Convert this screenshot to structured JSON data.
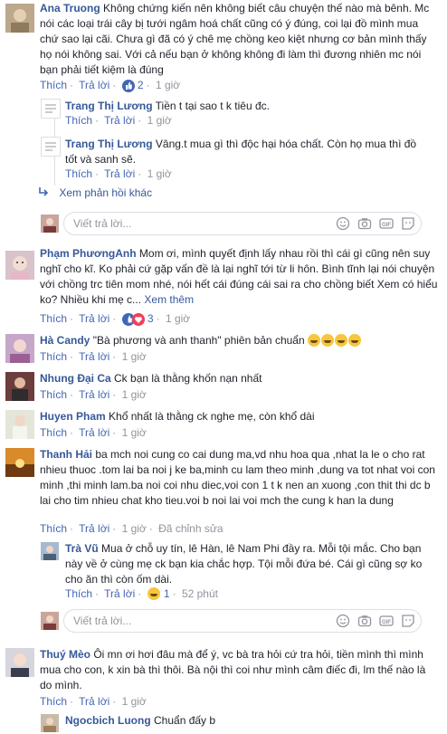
{
  "comments": [
    {
      "name": "Ana Truong",
      "text": "Không chứng kiến nên không biết câu chuyện thế nào mà bênh. Mc nói các loại trái cây bị tưới ngâm hoá chất cũng có ý đúng, coi lại đồ mình mua chứ sao lại cãi. Chưa gì đã có ý chê mẹ chồng keo kiệt nhưng cơ bản mình thấy họ nói không sai. Với cả nếu bạn ở không không đi làm thì đương nhiên mc nói bạn phải tiết kiệm là đúng",
      "like": "Thích",
      "reply": "Trả lời",
      "likes": "2",
      "time": "1 giờ"
    },
    {
      "name": "Trang Thị Lương",
      "text": "Tiền t tại sao t k tiêu đc.",
      "like": "Thích",
      "reply": "Trả lời",
      "time": "1 giờ"
    },
    {
      "name": "Trang Thị Lương",
      "text": "Vâng.t mua gì thì độc hại hóa chất. Còn họ mua thì đồ tốt và sanh sẽ.",
      "like": "Thích",
      "reply": "Trả lời",
      "time": "1 giờ"
    },
    {
      "name": "Phạm PhươngAnh",
      "text": "Mom ơi, mình quyết định lấy nhau rồi thì cái gì cũng nên suy nghĩ cho kĩ. Ko phải cứ gặp vấn đề là lại nghĩ tới từ li hôn. Bình tĩnh lại nói chuyện với chồng trc tiên mom nhé, nói hết cái đúng cái sai ra cho chồng biết Xem có hiểu ko? Nhiều khi mẹ c...",
      "more": "Xem thêm",
      "like": "Thích",
      "reply": "Trả lời",
      "likes": "3",
      "time": "1 giờ"
    },
    {
      "name": "Hà Candy",
      "text": "\"Bà phương và anh thanh\" phiên bản chuẩn",
      "like": "Thích",
      "reply": "Trả lời",
      "time": "1 giờ"
    },
    {
      "name": "Nhung Đại Ca",
      "text": "Ck bạn là thằng khốn nạn nhất",
      "like": "Thích",
      "reply": "Trả lời",
      "time": "1 giờ"
    },
    {
      "name": "Huyen Pham",
      "text": "Khổ nhất là thằng ck nghe mẹ, còn khổ dài",
      "like": "Thích",
      "reply": "Trả lời",
      "time": "1 giờ"
    },
    {
      "name": "Thanh Hải",
      "text": "ba mch noi cung co cai dung ma,vd nhu hoa qua ,nhat la le o cho rat nhieu thuoc .tom lai ba noi j ke ba,minh cu lam theo minh ,dung va tot nhat voi con minh ,thi minh lam.ba noi coi nhu diec,voi con 1 t k nen an xuong ,con thit thi dc b lai cho tim nhieu chat kho tieu.voi b noi lai voi mch the cung k han la dung",
      "like": "Thích",
      "reply": "Trả lời",
      "time": "1 giờ",
      "edited": "Đã chỉnh sửa"
    },
    {
      "name": "Trà Vũ",
      "text": "Mua ở chỗ uy tín, lê Hàn, lê Nam Phi đầy ra. Mỗi tội mắc. Cho bạn này về ở cùng mẹ ck bạn kia chắc hợp. Tội mỗi đứa bé. Cái gì cũng sợ ko cho ăn thì còn ốm dài.",
      "like": "Thích",
      "reply": "Trả lời",
      "likes": "1",
      "time": "52 phút"
    },
    {
      "name": "Thuý Mèo",
      "text": "Ôi mn ơi hơi đâu mà để ý, vc bà tra hỏi cứ tra hỏi, tiền mình thì mình mua cho con, k xin bà thì thôi. Bà nội thì coi như mình câm điếc đi, lm thế nào là do mình.",
      "like": "Thích",
      "reply": "Trả lời",
      "time": "1 giờ"
    },
    {
      "name": "Ngocbich Luong",
      "text": "Chuẩn đấy b"
    }
  ],
  "more_replies": "Xem phản hồi khác",
  "reply_placeholder": "Viết trả lời...",
  "colors": {
    "link": "#365899",
    "muted": "#90949c",
    "like_blue": "#4267b2"
  }
}
